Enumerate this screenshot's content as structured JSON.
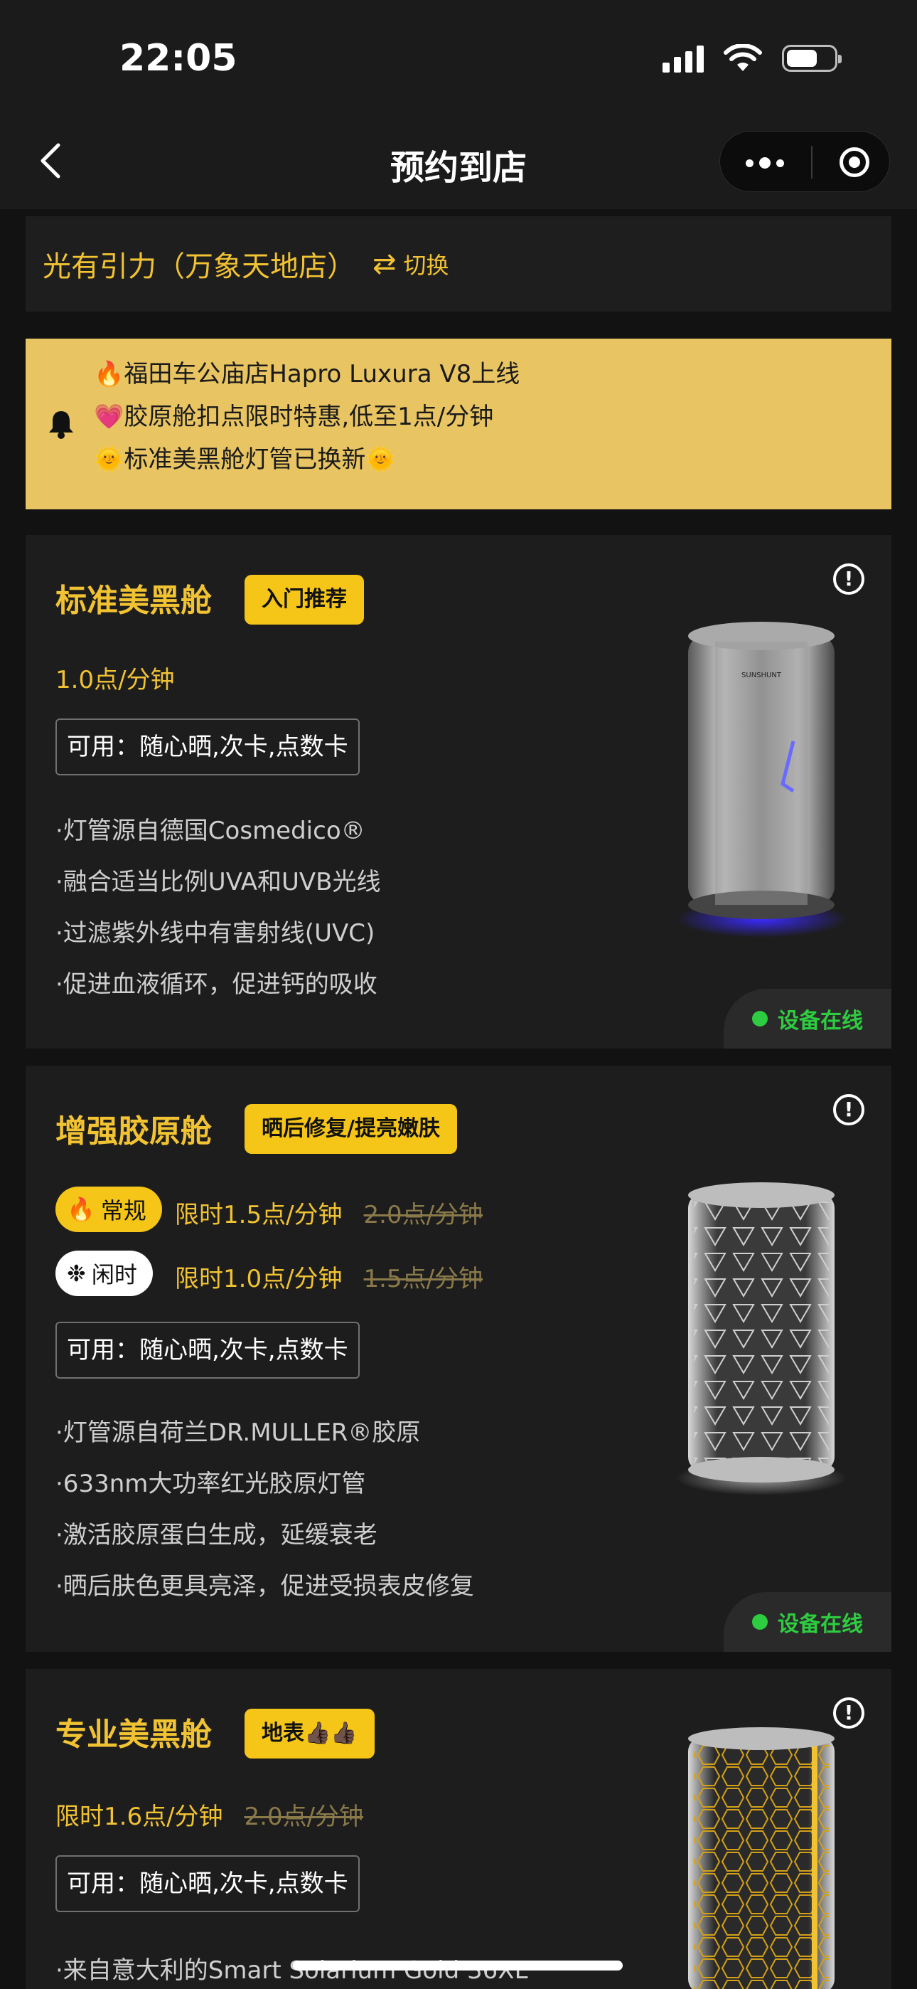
{
  "status_bar": {
    "time": "22:05"
  },
  "nav": {
    "title": "预约到店"
  },
  "store": {
    "name": "光有引力（万象天地店）",
    "switch_label": "切换"
  },
  "notice": {
    "lines": [
      "🔥福田车公庙店Hapro Luxura V8上线",
      "💗胶原舱扣点限时特惠,低至1点/分钟",
      "🌞标准美黑舱灯管已换新🌞"
    ]
  },
  "cards": [
    {
      "title": "标准美黑舱",
      "tag": "入门推荐",
      "price": "1.0点/分钟",
      "usable": "可用：随心晒,次卡,点数卡",
      "features": [
        "·灯管源自德国Cosmedico®",
        "·融合适当比例UVA和UVB光线",
        "·过滤紫外线中有害射线(UVC)",
        "·促进血液循环，促进钙的吸收"
      ],
      "online": "设备在线",
      "brand_text": "SUNSHUNT"
    },
    {
      "title": "增强胶原舱",
      "tag": "晒后修复/提亮嫩肤",
      "modes": [
        {
          "label": "常规",
          "price": "限时1.5点/分钟",
          "old_price": "2.0点/分钟"
        },
        {
          "label": "闲时",
          "price": "限时1.0点/分钟",
          "old_price": "1.5点/分钟"
        }
      ],
      "usable": "可用：随心晒,次卡,点数卡",
      "features": [
        "·灯管源自荷兰DR.MULLER®胶原",
        "·633nm大功率红光胶原灯管",
        "·激活胶原蛋白生成，延缓衰老",
        "·晒后肤色更具亮泽，促进受损表皮修复"
      ],
      "online": "设备在线"
    },
    {
      "title": "专业美黑舱",
      "tag": "地表👍🏿👍🏿",
      "price": "限时1.6点/分钟",
      "old_price": "2.0点/分钟",
      "usable": "可用：随心晒,次卡,点数卡",
      "features": [
        "·来自意大利的Smart Solarium Gold 36XL"
      ]
    }
  ],
  "colors": {
    "accent": "#f1c232",
    "tag_bg": "#f5c518",
    "notice_bg": "#e8c463",
    "online": "#2ecc40"
  }
}
